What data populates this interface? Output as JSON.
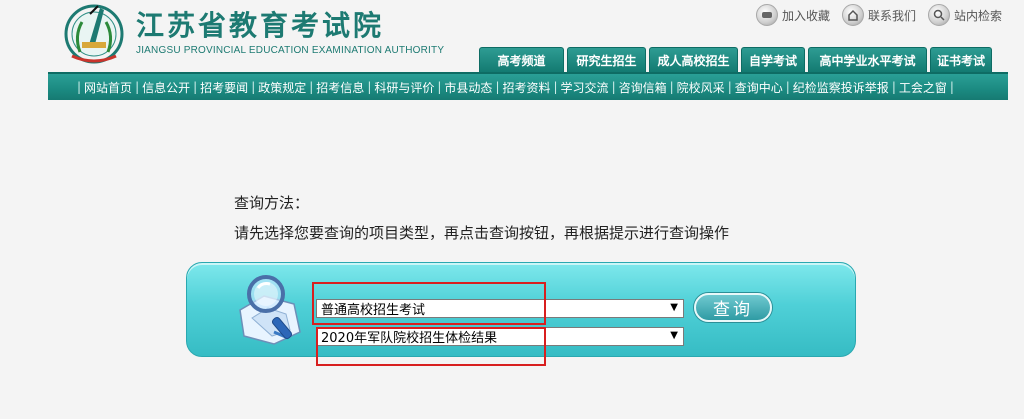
{
  "header": {
    "title": "江苏省教育考试院",
    "subtitle": "JIANGSU PROVINCIAL EDUCATION EXAMINATION AUTHORITY",
    "top_links": [
      {
        "label": "加入收藏",
        "icon": "bookmark-icon"
      },
      {
        "label": "联系我们",
        "icon": "home-icon"
      },
      {
        "label": "站内检索",
        "icon": "search-icon"
      }
    ],
    "tabs": [
      "高考频道",
      "研究生招生",
      "成人高校招生",
      "自学考试",
      "高中学业水平考试",
      "证书考试"
    ]
  },
  "nav": {
    "items": [
      "网站首页",
      "信息公开",
      "招考要闻",
      "政策规定",
      "招考信息",
      "科研与评价",
      "市县动态",
      "招考资料",
      "学习交流",
      "咨询信箱",
      "院校风采",
      "查询中心",
      "纪检监察投诉举报",
      "工会之窗"
    ]
  },
  "instructions": {
    "title": "查询方法：",
    "text": "请先选择您要查询的项目类型，再点击查询按钮，再根据提示进行查询操作"
  },
  "query": {
    "type_selected": "普通高校招生考试",
    "item_selected": "2020年军队院校招生体检结果",
    "button_label": "查询",
    "arrow": "▼"
  },
  "colors": {
    "brand": "#1d7a72",
    "panel": "#4fd0d7",
    "highlight": "#d81f1f"
  }
}
